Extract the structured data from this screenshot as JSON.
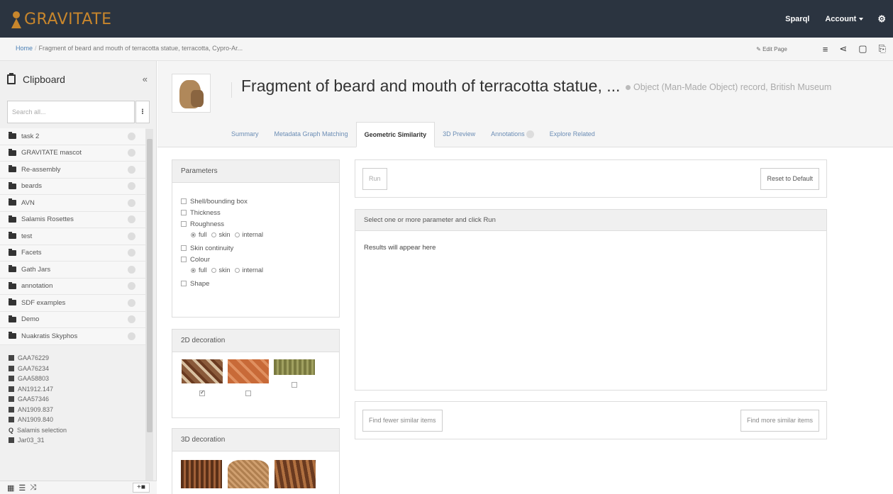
{
  "nav": {
    "logo": "GRAVITATE",
    "sparql": "Sparql",
    "account": "Account"
  },
  "breadcrumb": {
    "home": "Home",
    "current": "Fragment of beard and mouth of terracotta statue, terracotta, Cypro-Ar...",
    "edit_page": "Edit Page"
  },
  "sidebar": {
    "title": "Clipboard",
    "search_placeholder": "Search all...",
    "folders": [
      {
        "label": "task 2"
      },
      {
        "label": "GRAVITATE mascot"
      },
      {
        "label": "Re-assembly"
      },
      {
        "label": "beards"
      },
      {
        "label": "AVN"
      },
      {
        "label": "Salamis Rosettes"
      },
      {
        "label": "test"
      },
      {
        "label": "Facets"
      },
      {
        "label": "Gath Jars"
      },
      {
        "label": "annotation"
      },
      {
        "label": "SDF examples"
      },
      {
        "label": "Demo"
      },
      {
        "label": "Nuakratis Skyphos"
      }
    ],
    "items": [
      {
        "label": "GAA76229",
        "icon": "square"
      },
      {
        "label": "GAA76234",
        "icon": "square"
      },
      {
        "label": "GAA58803",
        "icon": "square"
      },
      {
        "label": "AN1912.147",
        "icon": "square"
      },
      {
        "label": "GAA57346",
        "icon": "square"
      },
      {
        "label": "AN1909.837",
        "icon": "square"
      },
      {
        "label": "AN1909.840",
        "icon": "square"
      },
      {
        "label": "Salamis selection",
        "icon": "query"
      },
      {
        "label": "Jar03_31",
        "icon": "square"
      }
    ]
  },
  "header": {
    "title": "Fragment of beard and mouth of terracotta statue, ...",
    "record": "Object (Man-Made Object) record, British Museum",
    "tabs": {
      "summary": "Summary",
      "metadata": "Metadata Graph Matching",
      "geometric": "Geometric Similarity",
      "preview": "3D Preview",
      "annotations": "Annotations",
      "explore": "Explore Related"
    }
  },
  "params": {
    "heading": "Parameters",
    "shell": "Shell/bounding box",
    "thickness": "Thickness",
    "roughness": "Roughness",
    "skin_continuity": "Skin continuity",
    "colour": "Colour",
    "shape": "Shape",
    "opt_full": "full",
    "opt_skin": "skin",
    "opt_internal": "internal"
  },
  "deco2d": {
    "heading": "2D decoration"
  },
  "deco3d": {
    "heading": "3D decoration"
  },
  "run": {
    "run_label": "Run",
    "reset_label": "Reset to Default"
  },
  "results": {
    "heading": "Select one or more parameter and click Run",
    "placeholder": "Results will appear here"
  },
  "find": {
    "fewer": "Find fewer similar items",
    "more": "Find more similar items"
  }
}
